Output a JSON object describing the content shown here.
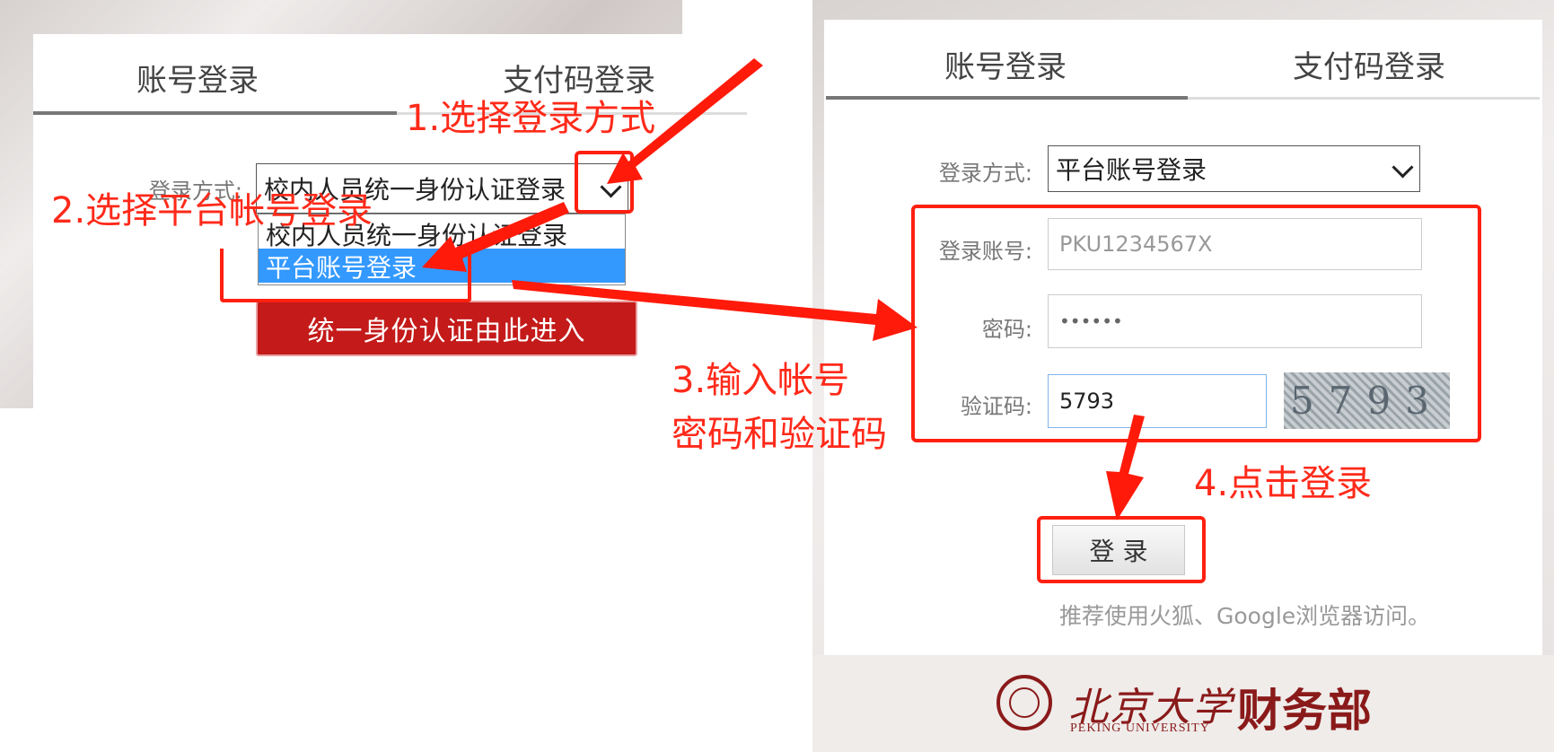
{
  "left": {
    "tabs": [
      "账号登录",
      "支付码登录"
    ],
    "login_method_label": "登录方式:",
    "select_value": "校内人员统一身份认证登录",
    "dropdown_options": [
      "校内人员统一身份认证登录",
      "平台账号登录"
    ],
    "sso_button_label": "统一身份认证由此进入"
  },
  "right": {
    "tabs": [
      "账号登录",
      "支付码登录"
    ],
    "login_method_label": "登录方式:",
    "select_value": "平台账号登录",
    "account_label": "登录账号:",
    "account_value": "PKU1234567X",
    "password_label": "密码:",
    "password_value": "••••••",
    "captcha_label": "验证码:",
    "captcha_value": "5793",
    "captcha_image_text": "5793",
    "login_button_label": "登 录",
    "hint": "推荐使用火狐、Google浏览器访问。",
    "footer": {
      "university_cn": "北京大学",
      "university_en": "PEKING UNIVERSITY",
      "department": "财务部"
    }
  },
  "annotations": {
    "step1": "1.选择登录方式",
    "step2": "2.选择平台帐号登录",
    "step3_line1": "3.输入帐号",
    "step3_line2": "密码和验证码",
    "step4": "4.点击登录"
  },
  "colors": {
    "annotation_red": "#ff2a1a",
    "sso_button_red": "#c41a1a",
    "dropdown_selected_blue": "#3399ff"
  }
}
